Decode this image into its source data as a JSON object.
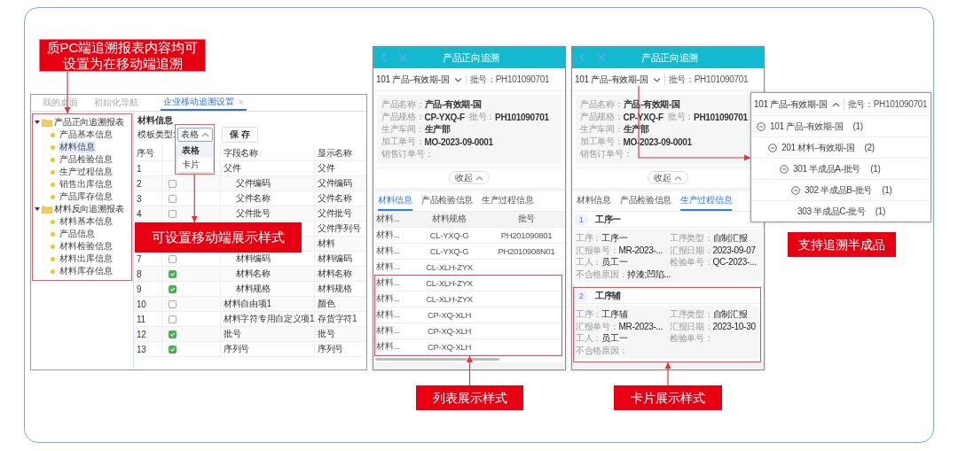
{
  "callouts": [
    {
      "kind": "intro",
      "text": "质PC端追溯报表内容均可设置为在移动端追溯"
    },
    {
      "kind": "style",
      "text": "可设置移动端展示样式"
    },
    {
      "kind": "list",
      "text": "列表展示样式"
    },
    {
      "kind": "card",
      "text": "卡片展示样式"
    },
    {
      "kind": "tree",
      "text": "支持追溯半成品"
    }
  ],
  "pc": {
    "tabs": [
      {
        "label": "我的桌面",
        "selected": false
      },
      {
        "label": "初始化导航",
        "selected": false
      },
      {
        "label": "企业移动追溯设置",
        "selected": true,
        "close": "×"
      }
    ],
    "sidebar": {
      "highlighted": true,
      "groups": [
        {
          "label": "产品正向追溯报表",
          "expanded": true,
          "children": [
            {
              "label": "产品基本信息",
              "selected": false
            },
            {
              "label": "材料信息",
              "selected": true
            },
            {
              "label": "产品检验信息",
              "selected": false
            },
            {
              "label": "生产过程信息",
              "selected": false
            },
            {
              "label": "销售出库信息",
              "selected": false
            },
            {
              "label": "产品库存信息",
              "selected": false
            }
          ]
        },
        {
          "label": "材料反向追溯报表",
          "expanded": true,
          "children": [
            {
              "label": "材料基本信息",
              "selected": false
            },
            {
              "label": "产品信息",
              "selected": false
            },
            {
              "label": "材料检验信息",
              "selected": false
            },
            {
              "label": "材料出库信息",
              "selected": false
            },
            {
              "label": "材料库存信息",
              "selected": false
            }
          ]
        }
      ]
    },
    "form": {
      "section": "材料信息",
      "template_label": "模板类型:",
      "template_value": "表格",
      "open": true,
      "highlighted": true,
      "options": [
        {
          "label": "表格",
          "selected": true
        },
        {
          "label": "卡片",
          "selected": false
        }
      ],
      "save": "保 存"
    },
    "table": {
      "columns": [
        "序号",
        "字段名称",
        "显示名称"
      ],
      "rows": [
        {
          "no": "1",
          "field": "父件",
          "display": "父件",
          "children": [
            {
              "no": "2",
              "checked": false,
              "field": "父件编码",
              "display": "父件编码"
            },
            {
              "no": "3",
              "checked": false,
              "field": "父件名称",
              "display": "父件名称"
            },
            {
              "no": "4",
              "checked": false,
              "field": "父件批号",
              "display": "父件批号"
            },
            {
              "display": "父件序列号"
            }
          ]
        },
        {
          "display": "材料",
          "children": [
            {
              "no": "7",
              "checked": false,
              "field": "材料编码",
              "display": "材料编码"
            },
            {
              "no": "8",
              "checked": true,
              "field": "材料名称",
              "display": "材料名称"
            },
            {
              "no": "9",
              "checked": true,
              "field": "材料规格",
              "display": "材料规格"
            }
          ]
        },
        {
          "no": "10",
          "checked": false,
          "field": "材料自由项1",
          "display": "颜色"
        },
        {
          "no": "11",
          "checked": false,
          "field": "材料字符专用自定义项1",
          "display": "存货字符1"
        },
        {
          "no": "12",
          "checked": true,
          "field": "批号",
          "display": "批号"
        },
        {
          "no": "13",
          "checked": true,
          "field": "序列号",
          "display": "序列号"
        }
      ]
    }
  },
  "phones": [
    {
      "kind": "list",
      "title": "产品正向追溯",
      "selector": {
        "value": "101 产品-有效期-国",
        "open": false,
        "batch": "批号：PH101090701"
      },
      "info": [
        {
          "label": "产品名称：",
          "value": "产品-有效期-国"
        },
        {
          "label": "产品规格：",
          "value": "CP-YXQ-F",
          "label2": "批号：",
          "value2": "PH101090701"
        },
        {
          "label": "生产车间：",
          "value": "生产部"
        },
        {
          "label": "加工单号：",
          "value": "MO-2023-09-0001"
        },
        {
          "label": "销售订单号："
        }
      ],
      "collapse": "收起",
      "tabs": [
        {
          "label": "材料信息",
          "selected": true
        },
        {
          "label": "产品检验信息",
          "selected": false
        },
        {
          "label": "生产过程信息",
          "selected": false
        }
      ],
      "table": {
        "columns": [
          "材料...",
          "材料规格",
          "批号"
        ],
        "rows": [
          {
            "cells": [
              "材料...",
              "CL-YXQ-G",
              "PH201090801"
            ],
            "highlighted": false
          },
          {
            "cells": [
              "材料...",
              "CL-YXQ-G",
              "PH2010908N01"
            ],
            "highlighted": false
          },
          {
            "cells": [
              "材料...",
              "CL-XLH-ZYX"
            ],
            "highlighted": false
          },
          {
            "cells": [
              "材料...",
              "CL-XLH-ZYX"
            ],
            "highlighted": true
          },
          {
            "cells": [
              "材料...",
              "CL-XLH-ZYX"
            ],
            "highlighted": true
          },
          {
            "cells": [
              "材料...",
              "CP-XQ-XLH"
            ],
            "highlighted": true
          },
          {
            "cells": [
              "材料...",
              "CP-XQ-XLH"
            ],
            "highlighted": true
          },
          {
            "cells": [
              "材料...",
              "CP-XQ-XLH"
            ],
            "highlighted": true
          }
        ]
      }
    },
    {
      "kind": "card",
      "title": "产品正向追溯",
      "selector": {
        "value": "101 产品-有效期-国",
        "open": false,
        "batch": "批号：PH101090701"
      },
      "info": [
        {
          "label": "产品名称：",
          "value": "产品-有效期-国"
        },
        {
          "label": "产品规格：",
          "value": "CP-YXQ-F",
          "label2": "批号：",
          "value2": "PH101090701"
        },
        {
          "label": "生产车间：",
          "value": "生产部"
        },
        {
          "label": "加工单号：",
          "value": "MO-2023-09-0001"
        },
        {
          "label": "销售订单号："
        }
      ],
      "collapse": "收起",
      "tabs": [
        {
          "label": "材料信息",
          "selected": false
        },
        {
          "label": "产品检验信息",
          "selected": false
        },
        {
          "label": "生产过程信息",
          "selected": true
        }
      ],
      "steps": [
        {
          "number": "1",
          "name": "工序一",
          "highlighted": false,
          "rows": [
            [
              {
                "label": "工序：",
                "value": "工序一"
              },
              {
                "label": "工序类型：",
                "value": "自制汇报"
              }
            ],
            [
              {
                "label": "汇报单号：",
                "value": "MR-2023-..."
              },
              {
                "label": "汇报日期：",
                "value": "2023-09-07"
              }
            ],
            [
              {
                "label": "工人：",
                "value": "员工一"
              },
              {
                "label": "检验单号：",
                "value": "QC-2023-..."
              }
            ],
            [
              {
                "label": "不合格原因：",
                "value": "掉漆;凹陷..."
              }
            ]
          ]
        },
        {
          "number": "2",
          "name": "工序辅",
          "highlighted": true,
          "rows": [
            [
              {
                "label": "工序：",
                "value": "工序辅"
              },
              {
                "label": "工序类型：",
                "value": "自制汇报"
              }
            ],
            [
              {
                "label": "汇报单号：",
                "value": "MR-2023-..."
              },
              {
                "label": "汇报日期：",
                "value": "2023-10-30"
              }
            ],
            [
              {
                "label": "工人：",
                "value": "员工一"
              },
              {
                "label": "检验单号："
              }
            ],
            [
              {
                "label": "不合格原因："
              }
            ]
          ]
        }
      ]
    }
  ],
  "popup": {
    "selector": {
      "value": "101 产品-有效期-国",
      "open": true,
      "batch": "批号：PH101090701"
    },
    "tree": [
      {
        "label": "101 产品-有效期-国",
        "count": "(1)",
        "expanded": true,
        "children": [
          {
            "label": "201 材料-有效期-国",
            "count": "(2)",
            "expanded": true,
            "children": [
              {
                "label": "301 半成品A-批号",
                "count": "(1)",
                "expanded": true,
                "children": [
                  {
                    "label": "302 半成品B-批号",
                    "count": "(1)",
                    "expanded": true,
                    "children": [
                      {
                        "label": "303 半成品C-批号",
                        "count": "(1)"
                      }
                    ]
                  }
                ]
              }
            ]
          }
        ]
      }
    ]
  }
}
